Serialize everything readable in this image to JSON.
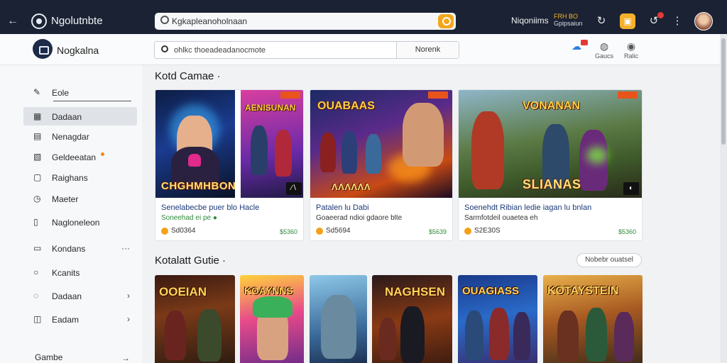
{
  "browser": {
    "app_title": "Ngolutnbte",
    "address": "Kgkapleanoholnaan",
    "right_label": "Niqoniims",
    "badge_top": "FRH BO",
    "badge_sub": "Gpipsaiun"
  },
  "header": {
    "brand": "Nogkalna",
    "search_placeholder": "ohlkc thoeadeadanocmote",
    "search_button": "Norenk",
    "actions": [
      {
        "label": ""
      },
      {
        "label": "Gaucs"
      },
      {
        "label": "Ralic"
      }
    ]
  },
  "sidebar": {
    "items": [
      {
        "label": "Eole",
        "icon": "feather-icon",
        "glyph": "✎",
        "right": ""
      },
      {
        "label": "Dadaan",
        "icon": "grid-icon",
        "glyph": "▦",
        "right": ""
      },
      {
        "label": "Nenagdar",
        "icon": "list-icon",
        "glyph": "▤",
        "right": ""
      },
      {
        "label": "Geldeeatan",
        "icon": "bookmark-icon",
        "glyph": "▧",
        "right": ""
      },
      {
        "label": "Raighans",
        "icon": "folder-icon",
        "glyph": "▢",
        "right": ""
      },
      {
        "label": "Maeter",
        "icon": "clock-icon",
        "glyph": "◷",
        "right": ""
      },
      {
        "label": "Nagloneleon",
        "icon": "document-icon",
        "glyph": "▯",
        "right": ""
      },
      {
        "label": "Kondans",
        "icon": "chat-icon",
        "glyph": "▭",
        "right": "···"
      },
      {
        "label": "Kcanits",
        "icon": "circle-icon",
        "glyph": "○",
        "right": ""
      },
      {
        "label": "Dadaan",
        "icon": "lock-icon",
        "glyph": "◌",
        "right": "›"
      },
      {
        "label": "Eadam",
        "icon": "tag-icon",
        "glyph": "◫",
        "right": "›"
      },
      {
        "label": "Gambe",
        "icon": "",
        "glyph": "",
        "right": "→"
      }
    ]
  },
  "sections": [
    {
      "title": "Kotd Camae ·"
    },
    {
      "title": "Kotalatt Gutie ·",
      "see_all": "Nobebr ouatsel"
    }
  ],
  "featured": [
    {
      "art_title": "CHGHMHBON",
      "art_top": "",
      "title": "Senelabecbe puer blo Hacle",
      "sub": "Soneehad ei pe ●",
      "price": "Sd0364",
      "right": "$5360"
    },
    {
      "art_title": "",
      "art_top": "AENISUNAN",
      "title": "",
      "sub": "",
      "price": "",
      "right": ""
    },
    {
      "art_title": "",
      "art_top": "OUABAAS",
      "title": "Patalen lu Dabi",
      "sub": "Goaeerad ndioi gdaore blte",
      "price": "Sd5694",
      "right": "$5639"
    },
    {
      "art_title": "SLIANAS",
      "art_top": "VONANAN",
      "title": "Soenehdt Ribian ledie iagan lu bnlan",
      "sub": "Sarmfotdeil ouaetea eh",
      "price": "S2E30S",
      "right": "$5360"
    }
  ],
  "row2": [
    {
      "title": "OOEIAN"
    },
    {
      "title": "KOAYNNS"
    },
    {
      "title": ""
    },
    {
      "title": "NAGHSEN"
    },
    {
      "title": "OUAGIASS"
    },
    {
      "title": "KOTAYSTEIN"
    }
  ]
}
